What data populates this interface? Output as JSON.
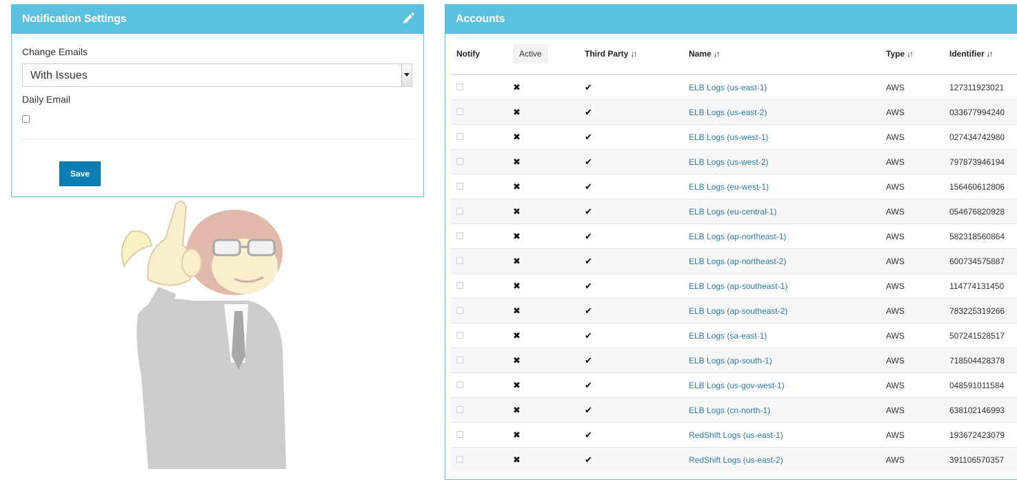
{
  "notification_panel": {
    "title": "Notification Settings",
    "change_emails_label": "Change Emails",
    "change_emails_value": "With Issues",
    "daily_email_label": "Daily Email",
    "daily_email_checked": false,
    "save_label": "Save"
  },
  "accounts_panel": {
    "title": "Accounts",
    "columns": {
      "notify": "Notify",
      "active": "Active",
      "third_party": "Third Party",
      "name": "Name",
      "type": "Type",
      "identifier": "Identifier"
    },
    "rows": [
      {
        "name": "ELB Logs (us-east-1)",
        "type": "AWS",
        "identifier": "127311923021"
      },
      {
        "name": "ELB Logs (us-east-2)",
        "type": "AWS",
        "identifier": "033677994240"
      },
      {
        "name": "ELB Logs (us-west-1)",
        "type": "AWS",
        "identifier": "027434742980"
      },
      {
        "name": "ELB Logs (us-west-2)",
        "type": "AWS",
        "identifier": "797873946194"
      },
      {
        "name": "ELB Logs (eu-west-1)",
        "type": "AWS",
        "identifier": "156460612806"
      },
      {
        "name": "ELB Logs (eu-central-1)",
        "type": "AWS",
        "identifier": "054676820928"
      },
      {
        "name": "ELB Logs (ap-northeast-1)",
        "type": "AWS",
        "identifier": "582318560864"
      },
      {
        "name": "ELB Logs (ap-northeast-2)",
        "type": "AWS",
        "identifier": "600734575887"
      },
      {
        "name": "ELB Logs (ap-southeast-1)",
        "type": "AWS",
        "identifier": "114774131450"
      },
      {
        "name": "ELB Logs (ap-southeast-2)",
        "type": "AWS",
        "identifier": "783225319266"
      },
      {
        "name": "ELB Logs (sa-east-1)",
        "type": "AWS",
        "identifier": "507241528517"
      },
      {
        "name": "ELB Logs (ap-south-1)",
        "type": "AWS",
        "identifier": "718504428378"
      },
      {
        "name": "ELB Logs (us-gov-west-1)",
        "type": "AWS",
        "identifier": "048591011584"
      },
      {
        "name": "ELB Logs (cn-north-1)",
        "type": "AWS",
        "identifier": "638102146993"
      },
      {
        "name": "RedShift Logs (us-east-1)",
        "type": "AWS",
        "identifier": "193672423079"
      },
      {
        "name": "RedShift Logs (us-east-2)",
        "type": "AWS",
        "identifier": "391106570357"
      }
    ]
  },
  "colors": {
    "header": "#5bc0de",
    "button": "#0c7eb3",
    "link": "#2a7ab0"
  },
  "icons": {
    "edit": "pencil-icon",
    "active": "x-mark-icon",
    "third_party": "checkmark-icon",
    "sort": "sort-icon"
  }
}
